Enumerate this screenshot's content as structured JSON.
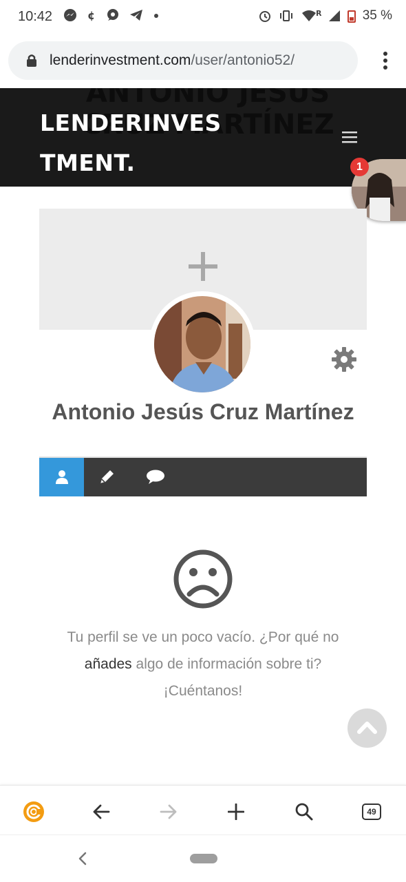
{
  "status": {
    "time": "10:42",
    "network_tag": "R",
    "battery": "35 %"
  },
  "browser": {
    "url_domain": "lenderinvestment.com",
    "url_path": "/user/antonio52/",
    "tab_count": "49"
  },
  "site": {
    "logo_line1": "LENDERINVES",
    "logo_line2": "TMENT.",
    "ghost_title": "ANTONIO JESÚS CRUZ MARTÍNEZ",
    "notification_count": "1"
  },
  "profile": {
    "name": "Antonio Jesús Cruz Martínez"
  },
  "tabs": [
    {
      "icon": "user-icon",
      "active": true
    },
    {
      "icon": "pencil-icon",
      "active": false
    },
    {
      "icon": "comment-icon",
      "active": false
    }
  ],
  "empty_state": {
    "text_before": "Tu perfil se ve un poco vacío. ¿Por qué no",
    "link": "añades",
    "text_after": "algo de información sobre ti? ¡Cuéntanos!"
  },
  "colors": {
    "header_bg": "#1a1a1a",
    "active_tab": "#3498db",
    "tabbar_bg": "#3b3b3b",
    "badge": "#e53935",
    "brand_orange": "#f39c12"
  }
}
